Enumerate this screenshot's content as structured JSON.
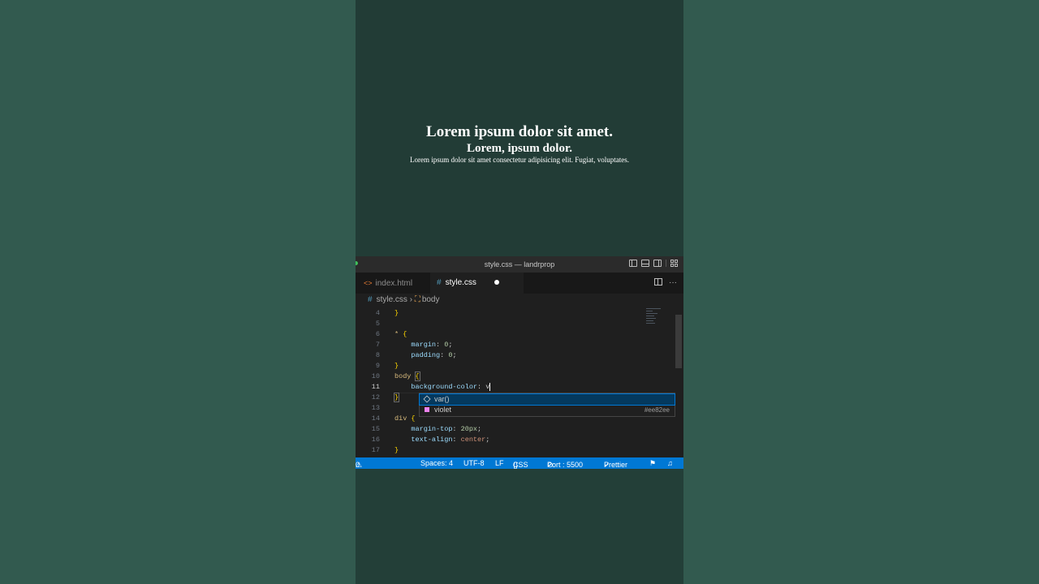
{
  "preview": {
    "heading1": "Lorem ipsum dolor sit amet.",
    "heading2": "Lorem, ipsum dolor.",
    "paragraph": "Lorem ipsum dolor sit amet consectetur adipisicing elit. Fugiat, voluptates."
  },
  "window": {
    "title": "style.css — landrprop"
  },
  "tabs": [
    {
      "label": "index.html",
      "icon": "html-file-icon",
      "active": false
    },
    {
      "label": "style.css",
      "icon": "css-file-icon",
      "active": true,
      "dirty": true
    }
  ],
  "breadcrumb": {
    "file": "style.css",
    "symbol": "body"
  },
  "editor": {
    "active_line": 11,
    "lines": [
      {
        "n": "4",
        "text": "}"
      },
      {
        "n": "5",
        "text": ""
      },
      {
        "n": "6",
        "text": "* {"
      },
      {
        "n": "7",
        "text": "    margin: 0;"
      },
      {
        "n": "8",
        "text": "    padding: 0;"
      },
      {
        "n": "9",
        "text": "}"
      },
      {
        "n": "10",
        "text": "body {"
      },
      {
        "n": "11",
        "text": "    background-color: v"
      },
      {
        "n": "12",
        "text": "}"
      },
      {
        "n": "13",
        "text": ""
      },
      {
        "n": "14",
        "text": "div {"
      },
      {
        "n": "15",
        "text": "    margin-top: 20px;"
      },
      {
        "n": "16",
        "text": "    text-align: center;"
      },
      {
        "n": "17",
        "text": "}"
      }
    ]
  },
  "suggestions": [
    {
      "label": "var()",
      "icon": "function-cube-icon",
      "detail": ""
    },
    {
      "label": "violet",
      "icon": "color-swatch-icon",
      "detail": "#ee82ee",
      "color": "#ee82ee"
    }
  ],
  "statusbar": {
    "problems": "0",
    "spaces": "Spaces: 4",
    "encoding": "UTF-8",
    "eol": "LF",
    "language": "CSS",
    "port": "Port : 5500",
    "prettier": "Prettier"
  },
  "colors": {
    "accent": "#0078d4",
    "preview_bg": "#223c36",
    "outer_bg": "#325a4f"
  }
}
